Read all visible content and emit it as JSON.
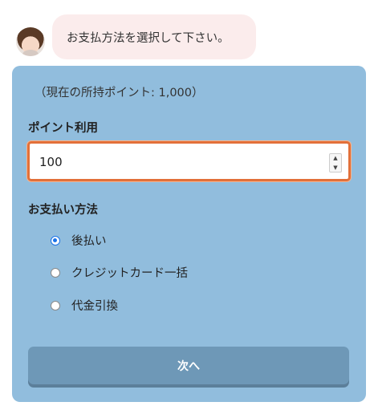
{
  "chat": {
    "message": "お支払方法を選択して下さい。"
  },
  "form": {
    "current_points": "（現在の所持ポイント: 1,000）",
    "points_label": "ポイント利用",
    "points_value": "100",
    "payment_label": "お支払い方法",
    "payment_options": [
      {
        "label": "後払い",
        "selected": true
      },
      {
        "label": "クレジットカード一括",
        "selected": false
      },
      {
        "label": "代金引換",
        "selected": false
      }
    ],
    "next_label": "次へ"
  },
  "colors": {
    "card_background": "#91bddd",
    "bubble_background": "#fbecec",
    "input_focus_border": "#e2703a",
    "button_background": "#6e98b7"
  },
  "icons": {
    "avatar": "operator-avatar",
    "spinner_up": "spinner-up-icon",
    "spinner_down": "spinner-down-icon"
  }
}
